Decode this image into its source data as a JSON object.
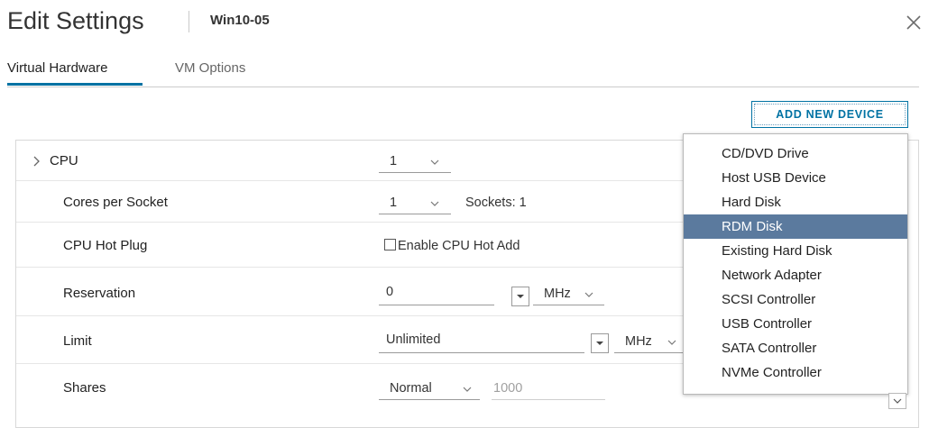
{
  "header": {
    "title": "Edit Settings",
    "vm_name": "Win10-05",
    "close_icon": "close-icon"
  },
  "tabs": [
    {
      "label": "Virtual Hardware",
      "active": true
    },
    {
      "label": "VM Options",
      "active": false
    }
  ],
  "toolbar": {
    "add_device_label": "ADD NEW DEVICE"
  },
  "cpu": {
    "label": "CPU",
    "value": "1",
    "cores_label": "Cores per Socket",
    "cores_value": "1",
    "sockets_text": "Sockets: 1",
    "hotplug_label": "CPU Hot Plug",
    "hotplug_checkbox_label": "Enable CPU Hot Add",
    "hotplug_checked": false,
    "reservation_label": "Reservation",
    "reservation_value": "0",
    "reservation_unit": "MHz",
    "limit_label": "Limit",
    "limit_value": "Unlimited",
    "limit_unit": "MHz",
    "shares_label": "Shares",
    "shares_value": "Normal",
    "shares_number": "1000"
  },
  "device_menu": {
    "items": [
      "CD/DVD Drive",
      "Host USB Device",
      "Hard Disk",
      "RDM Disk",
      "Existing Hard Disk",
      "Network Adapter",
      "SCSI Controller",
      "USB Controller",
      "SATA Controller",
      "NVMe Controller"
    ],
    "selected": "RDM Disk"
  },
  "colors": {
    "accent": "#0072a3",
    "menu_selected_bg": "#5b7a9e",
    "text": "#222222"
  }
}
